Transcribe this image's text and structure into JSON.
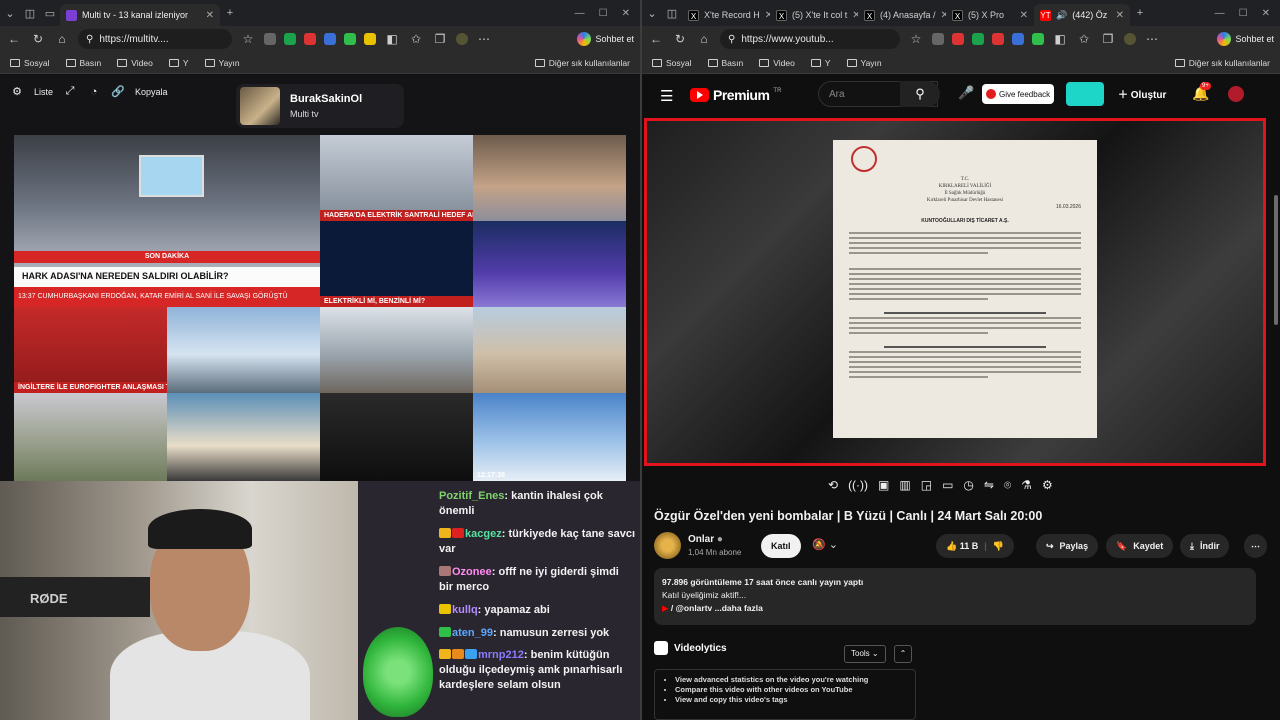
{
  "left_window": {
    "tab": {
      "title": "Multi tv - 13 kanal izleniyor"
    },
    "address": {
      "url": "https://multitv...."
    },
    "chat_button": "Sohbet et",
    "bookmarks": [
      "Sosyal",
      "Basın",
      "Video",
      "Y",
      "Yayın"
    ],
    "bookmarks_right": "Diğer sık kullanılanlar",
    "toolbar": {
      "list_label": "Liste",
      "copy_label": "Kopyala"
    },
    "channel": {
      "name": "BurakSakinOl",
      "subtitle": "Multi tv"
    },
    "tiles": {
      "big_headline": "HARK ADASI'NA NEREDEN SALDIRI OLABİLİR?",
      "big_top_bar": "SON DAKİKA",
      "big_ticker": "13:37  CUMHURBAŞKANI ERDOĞAN, KATAR EMİRİ AL SANİ İLE SAVAŞI GÖRÜŞTÜ",
      "t2": "HADERA'DA ELEKTRİK SANTRALİ HEDEF ALINDI",
      "t4": "ELEKTRİKLİ Mİ, BENZİNLİ Mİ?",
      "t6": "İNGİLTERE İLE EUROFIGHTER ANLAŞMASI TAMAM",
      "t13": "12:17:38"
    },
    "webcam_mic_label": "RØDE",
    "chat_messages": [
      {
        "user": "Pozitif_Enes",
        "text": "kantin ihalesi çok önemli",
        "color": "#7fd36b"
      },
      {
        "user": "kacgez",
        "text": "türkiyede kaç tane savcı var",
        "color": "#58e0a1"
      },
      {
        "user": "Ozonee",
        "text": "offf ne iyi giderdi şimdi bir merco",
        "color": "#ff8cf0"
      },
      {
        "user": "kullq",
        "text": "yapamaz abi",
        "color": "#b58cff"
      },
      {
        "user": "aten_99",
        "text": "namusun zerresi yok",
        "color": "#5aa8ff"
      },
      {
        "user": "mrnp212",
        "text": "benim kütüğün olduğu ilçedeymiş amk pınarhisarlı kardeşlere selam olsun",
        "color": "#8c7bff"
      }
    ]
  },
  "right_window": {
    "tabs": [
      {
        "title": "X'te Record H",
        "icon": "X"
      },
      {
        "title": "(5) X'te It col t",
        "icon": "X"
      },
      {
        "title": "(4) Anasayfa /",
        "icon": "X"
      },
      {
        "title": "(5) X Pro",
        "icon": "X"
      },
      {
        "title": "(442) Öz",
        "icon": "YT"
      }
    ],
    "address": {
      "url": "https://www.youtub..."
    },
    "chat_button": "Sohbet et",
    "bookmarks": [
      "Sosyal",
      "Basın",
      "Video",
      "Y",
      "Yayın"
    ],
    "bookmarks_right": "Diğer sık kullanılanlar",
    "youtube": {
      "logo": "Premium",
      "logo_sup": "TR",
      "search_placeholder": "Ara",
      "feedback_label": "Give feedback",
      "create_label": "Oluştur",
      "notif_count": "9+",
      "video_title": "Özgür Özel'den yeni bombalar | B Yüzü | Canlı | 24 Mart Salı 20:00",
      "channel_name": "Onlar",
      "subscribers": "1,04 Mn abone",
      "join_label": "Katıl",
      "likes": "11 B",
      "share_label": "Paylaş",
      "save_label": "Kaydet",
      "download_label": "İndir",
      "views": "97.896 görüntüleme",
      "streamed": "17 saat önce canlı yayın yaptı",
      "desc_line1": "Katıl üyeliğimiz aktif!...",
      "desc_handle": "/ @onlartv",
      "desc_more": "...daha fazla",
      "doc": {
        "header_lines": [
          "T.C.",
          "KIRKLARELİ VALİLİĞİ",
          "İl Sağlık Müdürlüğü",
          "Kırklareli Pınarhisar Devlet Hastanesi"
        ],
        "addressee": "KUNTOOĞULLARI DIŞ TİCARET A.Ş.",
        "date": "16.03.2026"
      },
      "videolytics": {
        "title": "Videolytics",
        "tools_label": "Tools",
        "items": [
          "View advanced statistics on the video you're watching",
          "Compare this video with other videos on YouTube",
          "View and copy this video's tags"
        ]
      }
    }
  }
}
